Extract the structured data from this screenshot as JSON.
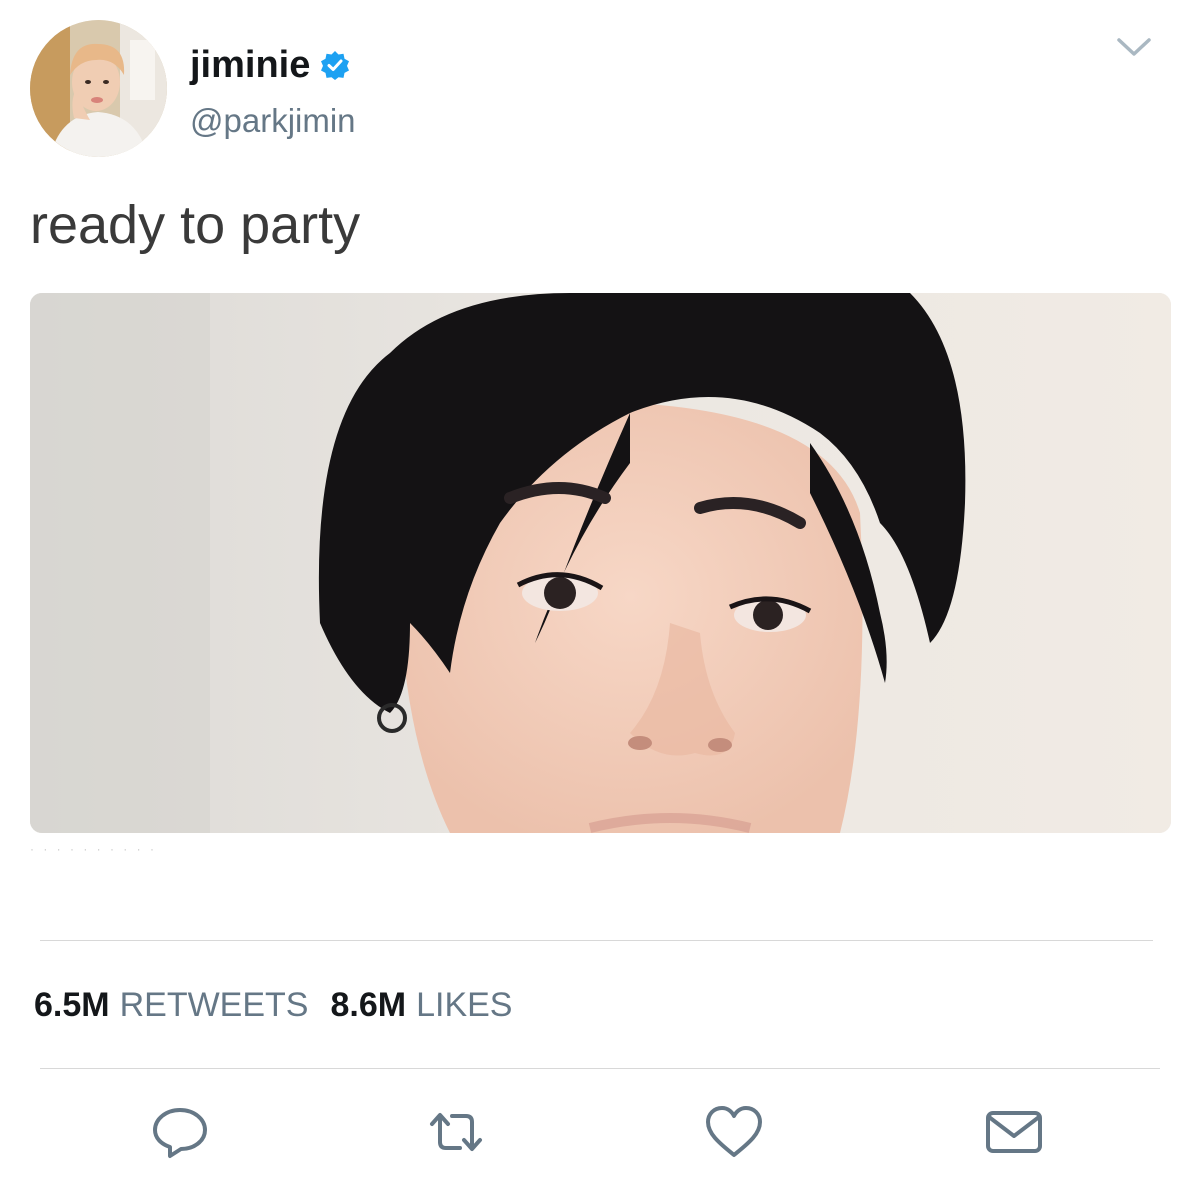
{
  "user": {
    "display_name": "jiminie",
    "handle": "@parkjimin",
    "verified_icon": "verified-badge-icon",
    "verified_color": "#1da1f2"
  },
  "tweet": {
    "text": "ready to party"
  },
  "stats": {
    "retweets_count": "6.5M",
    "retweets_label": "RETWEETS",
    "likes_count": "8.6M",
    "likes_label": "LIKES"
  },
  "actions": [
    {
      "icon": "reply-icon"
    },
    {
      "icon": "retweet-icon"
    },
    {
      "icon": "like-heart-icon"
    },
    {
      "icon": "direct-message-icon"
    }
  ],
  "menu_icon": "chevron-down-icon",
  "colors": {
    "text": "#14171a",
    "secondary": "#657786",
    "icon": "#657786",
    "divider": "#d8d8d8"
  }
}
